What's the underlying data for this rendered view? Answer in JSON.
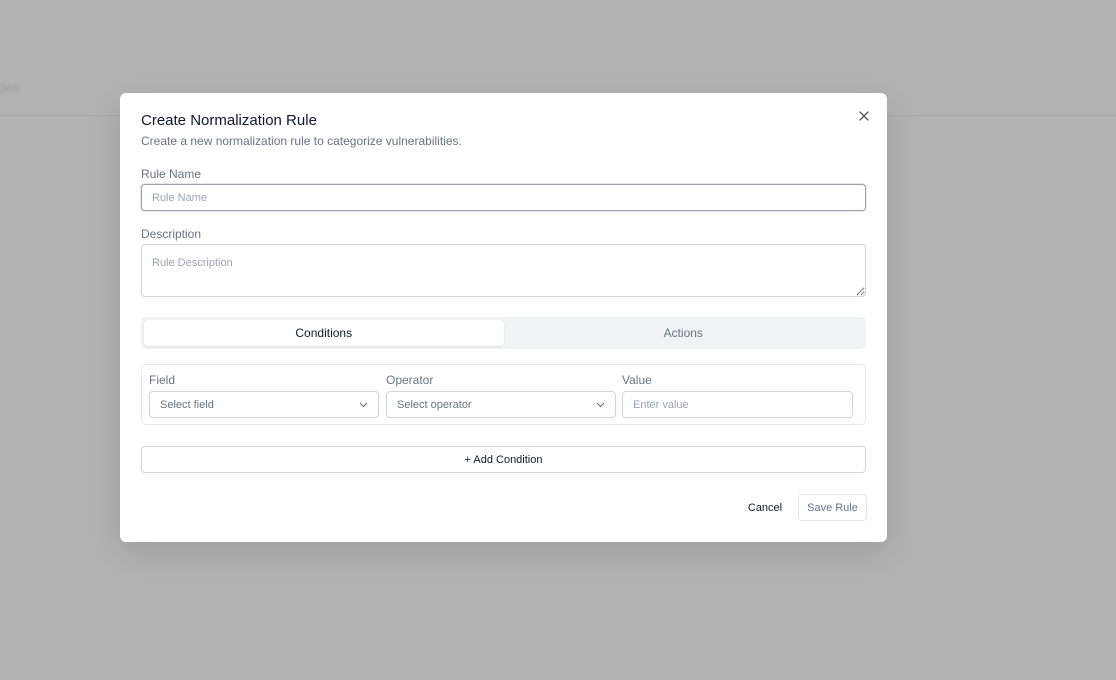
{
  "background": {
    "text": "cies"
  },
  "modal": {
    "title": "Create Normalization Rule",
    "subtitle": "Create a new normalization rule to categorize vulnerabilities.",
    "close_icon": "close-icon"
  },
  "form": {
    "rule_name": {
      "label": "Rule Name",
      "placeholder": "Rule Name",
      "value": ""
    },
    "description": {
      "label": "Description",
      "placeholder": "Rule Description",
      "value": ""
    }
  },
  "tabs": [
    {
      "label": "Conditions",
      "active": true
    },
    {
      "label": "Actions",
      "active": false
    }
  ],
  "condition": {
    "field": {
      "label": "Field",
      "placeholder": "Select field"
    },
    "operator": {
      "label": "Operator",
      "placeholder": "Select operator"
    },
    "value": {
      "label": "Value",
      "placeholder": "Enter value"
    }
  },
  "buttons": {
    "add_condition": "+ Add Condition",
    "cancel": "Cancel",
    "save": "Save Rule"
  },
  "colors": {
    "overlay": "#b2b2b2",
    "modal_bg": "#ffffff",
    "tab_bg": "#f1f2f4",
    "border": "#d1d5db"
  }
}
